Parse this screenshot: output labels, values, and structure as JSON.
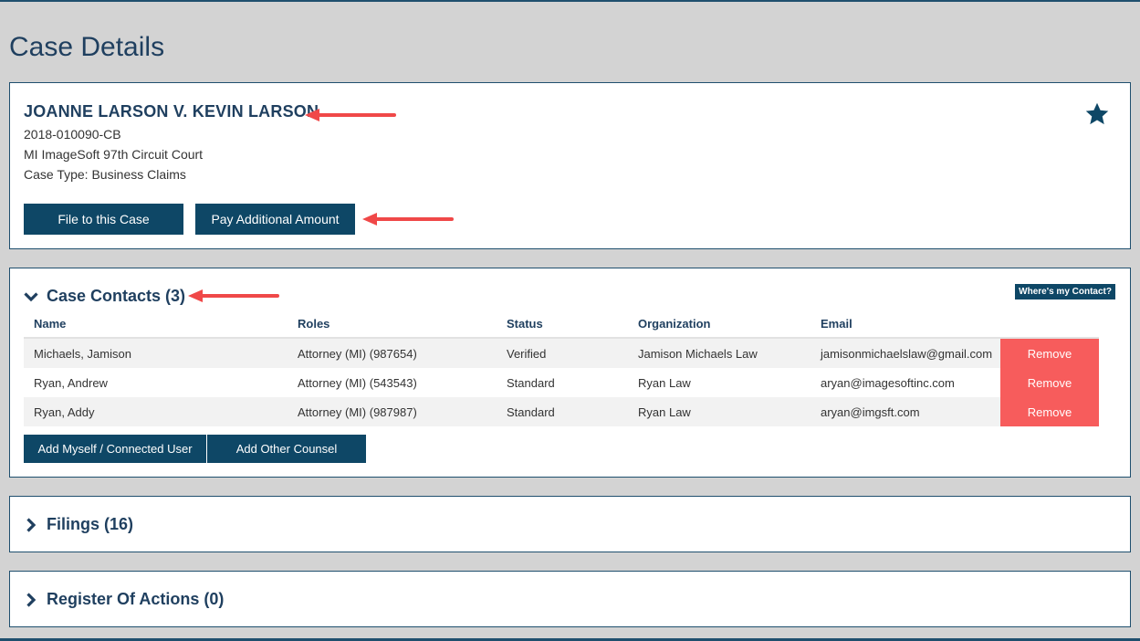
{
  "page": {
    "title": "Case Details"
  },
  "case": {
    "title": "JOANNE LARSON V. KEVIN LARSON",
    "number": "2018-010090-CB",
    "court": "MI ImageSoft 97th Circuit Court",
    "case_type": "Case Type: Business Claims",
    "file_button": "File to this Case",
    "pay_button": "Pay Additional Amount",
    "favorite_icon": "star-icon"
  },
  "contacts": {
    "title": "Case Contacts (3)",
    "wheres_contact": "Where's my Contact?",
    "columns": [
      "Name",
      "Roles",
      "Status",
      "Organization",
      "Email"
    ],
    "rows": [
      {
        "name": "Michaels, Jamison",
        "roles": "Attorney (MI) (987654)",
        "status": "Verified",
        "organization": "Jamison Michaels Law",
        "email": "jamisonmichaelslaw@gmail.com",
        "action": "Remove"
      },
      {
        "name": "Ryan, Andrew",
        "roles": "Attorney (MI) (543543)",
        "status": "Standard",
        "organization": "Ryan Law",
        "email": "aryan@imagesoftinc.com",
        "action": "Remove"
      },
      {
        "name": "Ryan, Addy",
        "roles": "Attorney (MI) (987987)",
        "status": "Standard",
        "organization": "Ryan Law",
        "email": "aryan@imgsft.com",
        "action": "Remove"
      }
    ],
    "add_myself": "Add Myself / Connected User",
    "add_other": "Add Other Counsel"
  },
  "filings": {
    "title": "Filings (16)"
  },
  "register": {
    "title": "Register Of Actions (0)"
  },
  "colors": {
    "brand": "#0e4766",
    "remove": "#f75c5c",
    "arrow": "#f04848",
    "background": "#d3d3d3"
  }
}
